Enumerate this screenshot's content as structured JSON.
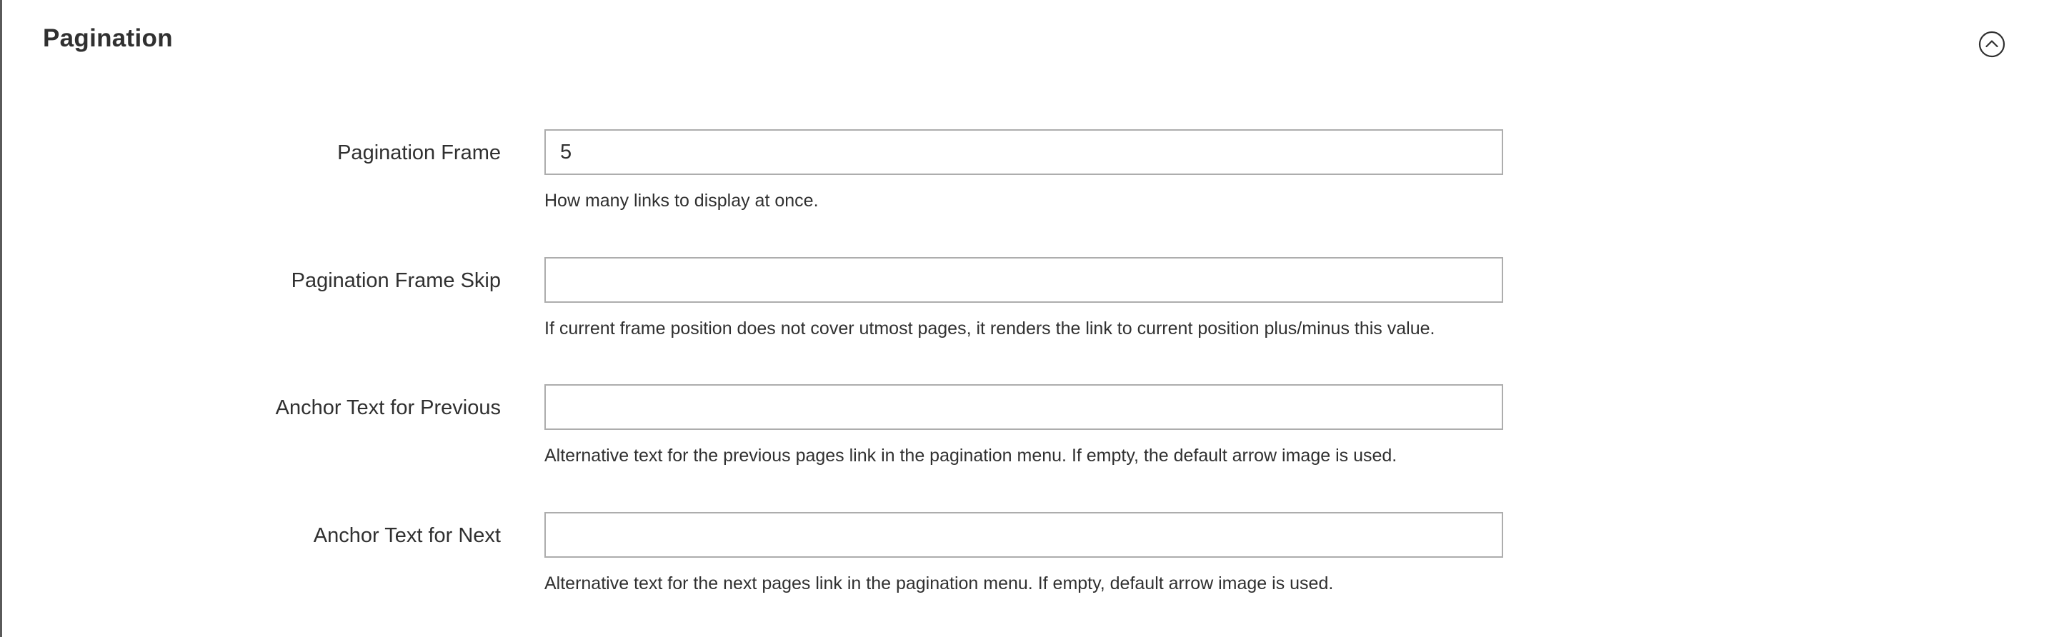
{
  "section": {
    "title": "Pagination",
    "toggle_icon": "chevron-up-circle-icon"
  },
  "fields": [
    {
      "label": "Pagination Frame",
      "value": "5",
      "placeholder": "",
      "note": "How many links to display at once."
    },
    {
      "label": "Pagination Frame Skip",
      "value": "",
      "placeholder": "",
      "note": "If current frame position does not cover utmost pages, it renders the link to current position plus/minus this value."
    },
    {
      "label": "Anchor Text for Previous",
      "value": "",
      "placeholder": "",
      "note": "Alternative text for the previous pages link in the pagination menu. If empty, the default arrow image is used."
    },
    {
      "label": "Anchor Text for Next",
      "value": "",
      "placeholder": "",
      "note": "Alternative text for the next pages link in the pagination menu. If empty, default arrow image is used."
    }
  ]
}
